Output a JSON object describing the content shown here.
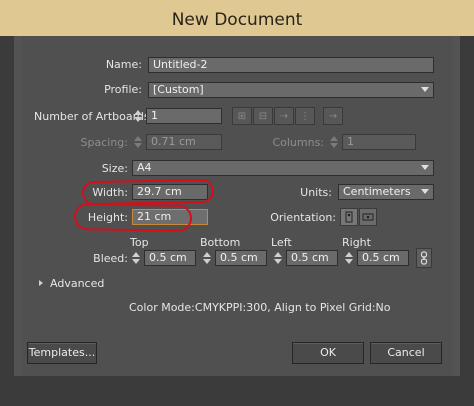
{
  "window": {
    "title": "New Document"
  },
  "form": {
    "name": {
      "label": "Name:",
      "value": "Untitled-2"
    },
    "profile": {
      "label": "Profile:",
      "value": "[Custom]"
    },
    "artboards": {
      "label": "Number of Artboards:",
      "value": "1"
    },
    "spacing": {
      "label": "Spacing:",
      "value": "0.71 cm"
    },
    "columns": {
      "label": "Columns:",
      "value": "1"
    },
    "size": {
      "label": "Size:",
      "value": "A4"
    },
    "width": {
      "label": "Width:",
      "value": "29.7 cm"
    },
    "units": {
      "label": "Units:",
      "value": "Centimeters"
    },
    "height": {
      "label": "Height:",
      "value": "21 cm"
    },
    "orientation": {
      "label": "Orientation:"
    },
    "bleed": {
      "label": "Bleed:",
      "top": {
        "label": "Top",
        "value": "0.5 cm"
      },
      "bottom": {
        "label": "Bottom",
        "value": "0.5 cm"
      },
      "left": {
        "label": "Left",
        "value": "0.5 cm"
      },
      "right": {
        "label": "Right",
        "value": "0.5 cm"
      }
    },
    "advanced": {
      "label": "Advanced"
    },
    "color_mode": "Color Mode:CMYKPPI:300, Align to Pixel Grid:No"
  },
  "buttons": {
    "templates": "Templates...",
    "ok": "OK",
    "cancel": "Cancel"
  },
  "colors": {
    "title_bar": "#dfc891",
    "dialog_bg": "#505050",
    "annotation": "#d40f1a"
  }
}
